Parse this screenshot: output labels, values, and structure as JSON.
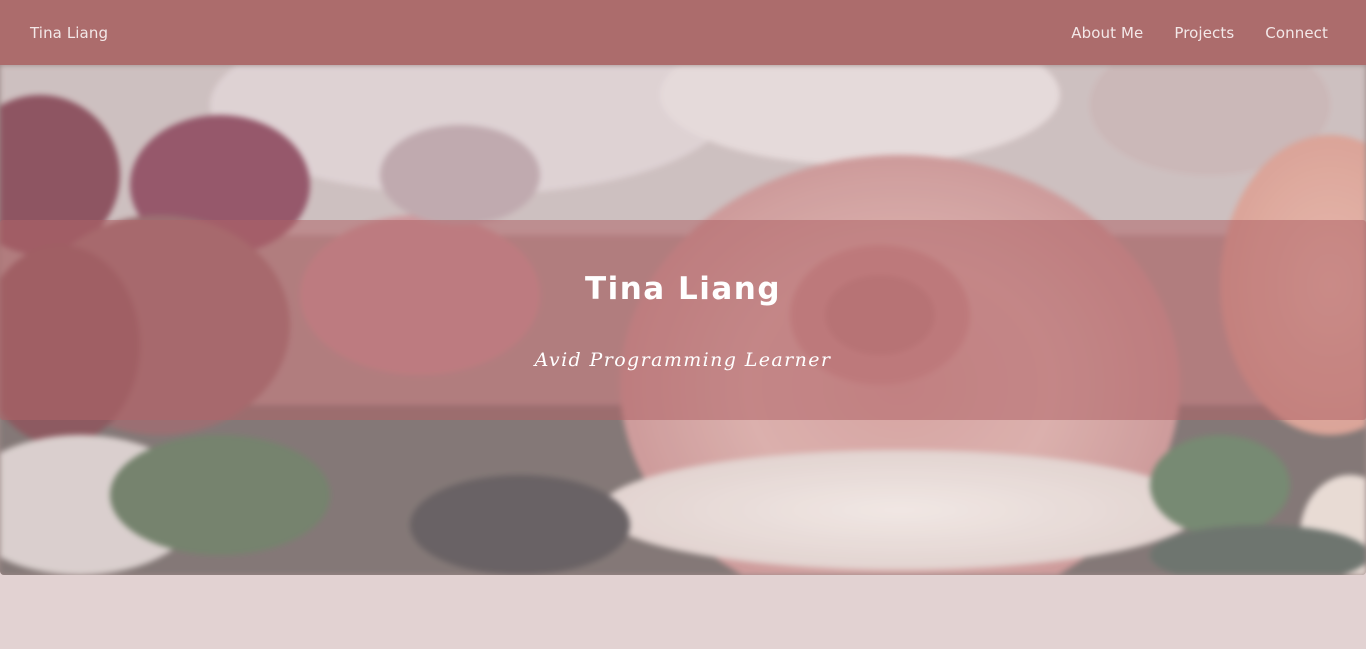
{
  "navbar": {
    "brand": "Tina Liang",
    "links": [
      {
        "label": "About Me"
      },
      {
        "label": "Projects"
      },
      {
        "label": "Connect"
      }
    ]
  },
  "hero": {
    "title": "Tina Liang",
    "subtitle": "Avid Programming Learner",
    "background": "rose-bouquet-photo"
  },
  "colors": {
    "navbar": "#ac6c6c",
    "banner_overlay": "#b06468",
    "page_background": "#e2d2d2",
    "text": "#ffffff"
  }
}
